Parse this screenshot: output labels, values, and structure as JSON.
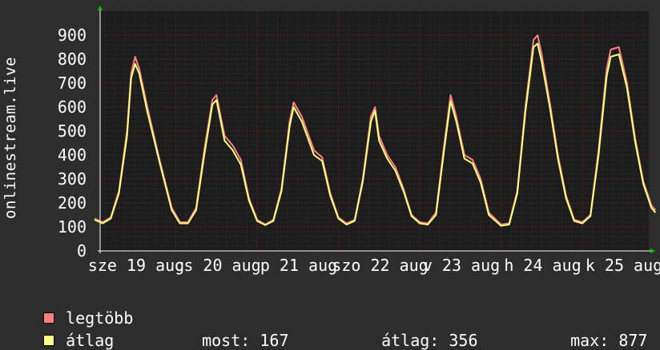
{
  "colors": {
    "background": "#2d2d2d",
    "plot_bg": "#1c1c1c",
    "grid_minor": "#3a3a3a",
    "grid_major": "#7a2a2a",
    "max_series": "#ff7f7f",
    "avg_series": "#ffff80",
    "axis_arrow": "#00cc00"
  },
  "legend": {
    "max_label": "legtöbb",
    "avg_label": "átlag"
  },
  "stats": {
    "now_label": "most:",
    "now_value": "167",
    "avg_label": "átlag:",
    "avg_value": "356",
    "max_label": "max:",
    "max_value": "877"
  },
  "chart_data": {
    "type": "line",
    "title": "",
    "ylabel": "onlinestream.live",
    "xlabel": "",
    "ylim": [
      0,
      950
    ],
    "yticks": [
      0,
      100,
      200,
      300,
      400,
      500,
      600,
      700,
      800,
      900
    ],
    "xlim_days": [
      0,
      7.3
    ],
    "xtick_labels": [
      {
        "label": "sze 19 aug",
        "day": 0.0
      },
      {
        "label": "cs 20 aug",
        "day": 1.0
      },
      {
        "label": "p 21 aug",
        "day": 2.0
      },
      {
        "label": "szo 22 aug",
        "day": 3.0
      },
      {
        "label": "v 23 aug",
        "day": 4.0
      },
      {
        "label": "h 24 aug",
        "day": 5.0
      },
      {
        "label": "k 25 aug",
        "day": 6.0
      }
    ],
    "grid": true,
    "series": [
      {
        "name": "legtöbb",
        "color": "#ff7f7f",
        "values": [
          [
            0.0,
            135
          ],
          [
            0.1,
            120
          ],
          [
            0.2,
            140
          ],
          [
            0.3,
            250
          ],
          [
            0.4,
            500
          ],
          [
            0.45,
            740
          ],
          [
            0.5,
            810
          ],
          [
            0.55,
            760
          ],
          [
            0.65,
            600
          ],
          [
            0.8,
            380
          ],
          [
            0.95,
            180
          ],
          [
            1.05,
            120
          ],
          [
            1.15,
            120
          ],
          [
            1.25,
            180
          ],
          [
            1.35,
            420
          ],
          [
            1.45,
            630
          ],
          [
            1.5,
            650
          ],
          [
            1.6,
            480
          ],
          [
            1.7,
            440
          ],
          [
            1.8,
            380
          ],
          [
            1.9,
            220
          ],
          [
            2.0,
            130
          ],
          [
            2.1,
            110
          ],
          [
            2.2,
            130
          ],
          [
            2.3,
            260
          ],
          [
            2.4,
            540
          ],
          [
            2.45,
            620
          ],
          [
            2.55,
            560
          ],
          [
            2.7,
            420
          ],
          [
            2.8,
            390
          ],
          [
            2.9,
            240
          ],
          [
            3.0,
            140
          ],
          [
            3.1,
            115
          ],
          [
            3.2,
            130
          ],
          [
            3.3,
            300
          ],
          [
            3.4,
            560
          ],
          [
            3.45,
            600
          ],
          [
            3.5,
            480
          ],
          [
            3.6,
            400
          ],
          [
            3.7,
            350
          ],
          [
            3.8,
            260
          ],
          [
            3.9,
            150
          ],
          [
            4.0,
            120
          ],
          [
            4.1,
            115
          ],
          [
            4.2,
            160
          ],
          [
            4.3,
            440
          ],
          [
            4.38,
            650
          ],
          [
            4.45,
            560
          ],
          [
            4.55,
            400
          ],
          [
            4.65,
            380
          ],
          [
            4.75,
            300
          ],
          [
            4.85,
            160
          ],
          [
            5.0,
            110
          ],
          [
            5.1,
            115
          ],
          [
            5.2,
            250
          ],
          [
            5.3,
            600
          ],
          [
            5.4,
            880
          ],
          [
            5.45,
            900
          ],
          [
            5.5,
            820
          ],
          [
            5.6,
            620
          ],
          [
            5.7,
            400
          ],
          [
            5.8,
            230
          ],
          [
            5.9,
            130
          ],
          [
            6.0,
            120
          ],
          [
            6.1,
            150
          ],
          [
            6.2,
            420
          ],
          [
            6.3,
            760
          ],
          [
            6.35,
            840
          ],
          [
            6.45,
            850
          ],
          [
            6.55,
            700
          ],
          [
            6.65,
            470
          ],
          [
            6.75,
            290
          ],
          [
            6.85,
            190
          ],
          [
            6.9,
            170
          ]
        ]
      },
      {
        "name": "átlag",
        "color": "#ffff80",
        "values": [
          [
            0.0,
            130
          ],
          [
            0.1,
            115
          ],
          [
            0.2,
            135
          ],
          [
            0.3,
            240
          ],
          [
            0.4,
            480
          ],
          [
            0.45,
            720
          ],
          [
            0.5,
            780
          ],
          [
            0.55,
            740
          ],
          [
            0.65,
            580
          ],
          [
            0.8,
            370
          ],
          [
            0.95,
            170
          ],
          [
            1.05,
            115
          ],
          [
            1.15,
            115
          ],
          [
            1.25,
            170
          ],
          [
            1.35,
            400
          ],
          [
            1.45,
            610
          ],
          [
            1.5,
            630
          ],
          [
            1.6,
            460
          ],
          [
            1.7,
            420
          ],
          [
            1.8,
            360
          ],
          [
            1.9,
            210
          ],
          [
            2.0,
            125
          ],
          [
            2.1,
            108
          ],
          [
            2.2,
            125
          ],
          [
            2.3,
            250
          ],
          [
            2.4,
            520
          ],
          [
            2.45,
            600
          ],
          [
            2.55,
            540
          ],
          [
            2.7,
            400
          ],
          [
            2.8,
            375
          ],
          [
            2.9,
            230
          ],
          [
            3.0,
            135
          ],
          [
            3.1,
            110
          ],
          [
            3.2,
            125
          ],
          [
            3.3,
            290
          ],
          [
            3.4,
            540
          ],
          [
            3.45,
            585
          ],
          [
            3.5,
            460
          ],
          [
            3.6,
            385
          ],
          [
            3.7,
            335
          ],
          [
            3.8,
            250
          ],
          [
            3.9,
            145
          ],
          [
            4.0,
            115
          ],
          [
            4.1,
            110
          ],
          [
            4.2,
            150
          ],
          [
            4.3,
            420
          ],
          [
            4.38,
            625
          ],
          [
            4.45,
            540
          ],
          [
            4.55,
            385
          ],
          [
            4.65,
            365
          ],
          [
            4.75,
            285
          ],
          [
            4.85,
            150
          ],
          [
            5.0,
            105
          ],
          [
            5.1,
            110
          ],
          [
            5.2,
            240
          ],
          [
            5.3,
            580
          ],
          [
            5.4,
            850
          ],
          [
            5.45,
            865
          ],
          [
            5.5,
            790
          ],
          [
            5.6,
            600
          ],
          [
            5.7,
            385
          ],
          [
            5.8,
            220
          ],
          [
            5.9,
            125
          ],
          [
            6.0,
            115
          ],
          [
            6.1,
            145
          ],
          [
            6.2,
            400
          ],
          [
            6.3,
            730
          ],
          [
            6.35,
            810
          ],
          [
            6.45,
            820
          ],
          [
            6.55,
            680
          ],
          [
            6.65,
            455
          ],
          [
            6.75,
            280
          ],
          [
            6.85,
            180
          ],
          [
            6.9,
            160
          ]
        ]
      }
    ]
  }
}
